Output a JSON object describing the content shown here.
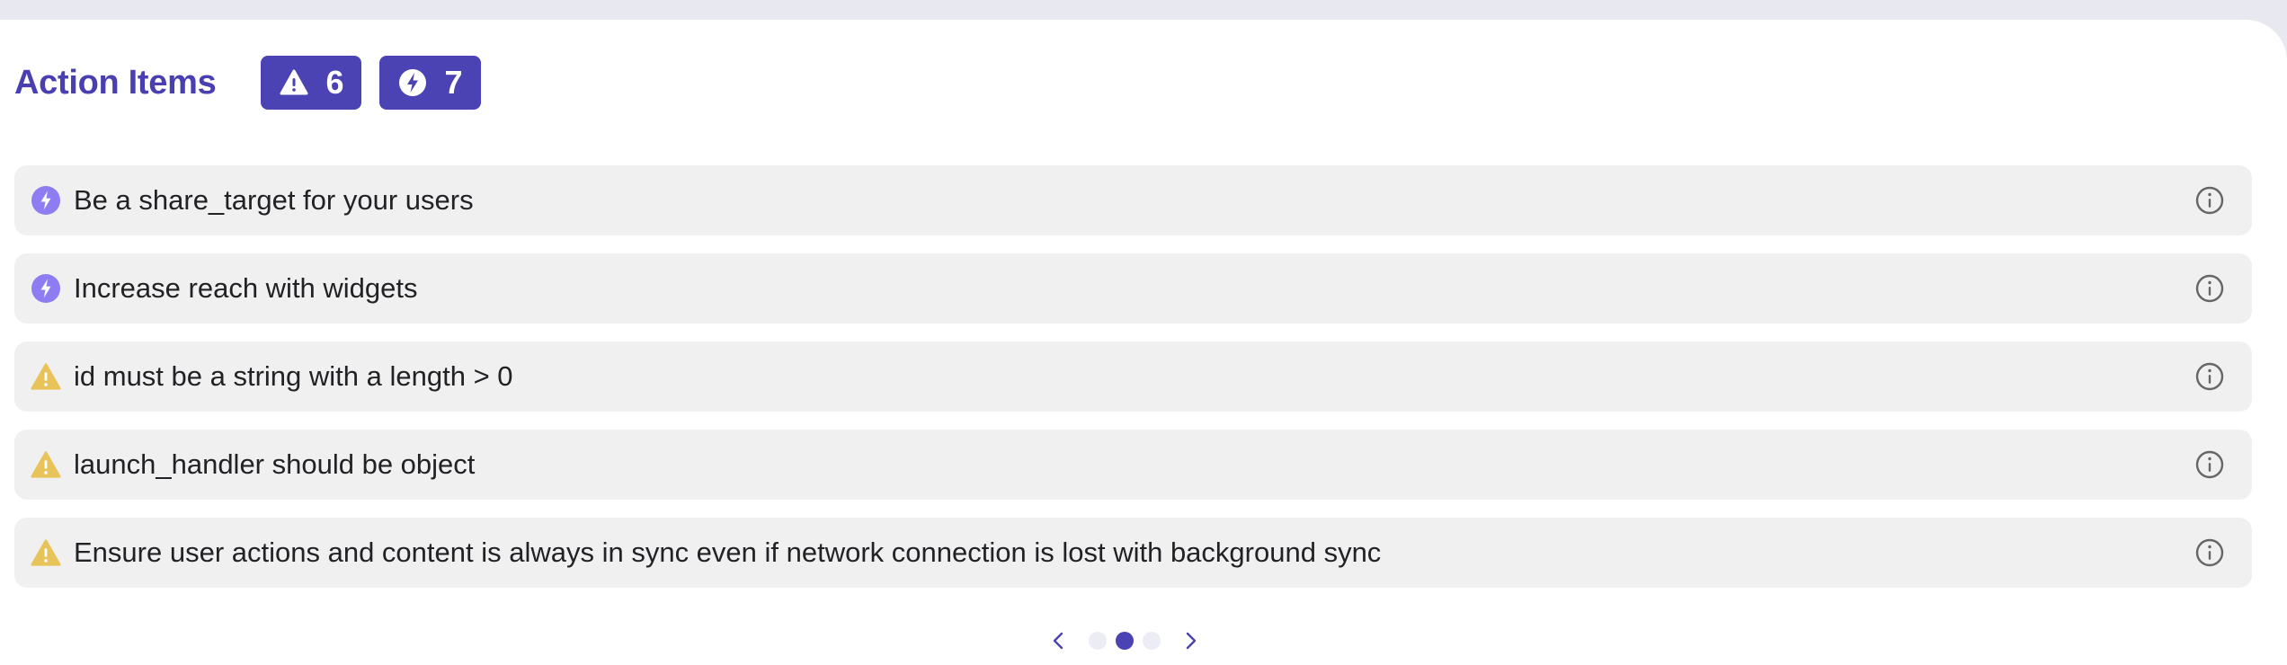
{
  "header": {
    "title": "Action Items",
    "badges": [
      {
        "icon": "warning-icon",
        "count": "6"
      },
      {
        "icon": "bolt-icon",
        "count": "7"
      }
    ]
  },
  "items": [
    {
      "icon": "bolt-icon",
      "text": "Be a share_target for your users"
    },
    {
      "icon": "bolt-icon",
      "text": "Increase reach with widgets"
    },
    {
      "icon": "warning-icon",
      "text": "id must be a string with a length > 0"
    },
    {
      "icon": "warning-icon",
      "text": "launch_handler should be object"
    },
    {
      "icon": "warning-icon",
      "text": "Ensure user actions and content is always in sync even if network connection is lost with background sync"
    }
  ],
  "pagination": {
    "pages": 3,
    "current": 2
  },
  "colors": {
    "accent": "#4b42b3",
    "bolt": "#8e7cf3",
    "warning": "#e8c35a",
    "item_bg": "#f0f0f0",
    "page_bg": "#e8e8f1"
  }
}
